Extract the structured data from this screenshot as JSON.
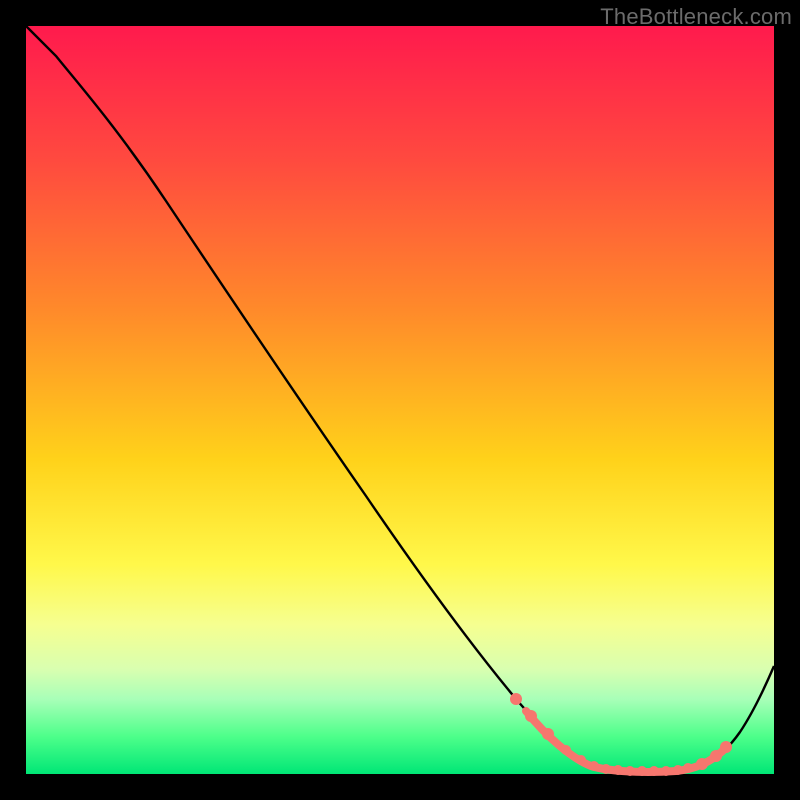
{
  "watermark": {
    "text": "TheBottleneck.com"
  },
  "chart_data": {
    "type": "line",
    "title": "",
    "xlabel": "",
    "ylabel": "",
    "xlim": [
      0,
      100
    ],
    "ylim": [
      0,
      100
    ],
    "grid": false,
    "series": [
      {
        "name": "bottleneck-curve",
        "x": [
          0,
          4,
          12,
          20,
          28,
          36,
          44,
          52,
          58,
          62,
          66,
          70,
          73,
          76,
          79,
          82,
          85,
          88,
          91,
          94,
          97,
          100
        ],
        "values": [
          100,
          96,
          87,
          76,
          65,
          54,
          43,
          32,
          24,
          18,
          12,
          7,
          4,
          2,
          1,
          0.5,
          0.5,
          1,
          3,
          6,
          12,
          20
        ]
      }
    ],
    "marker_band": {
      "x_start": 64,
      "x_end": 93,
      "color": "#f6766e"
    },
    "colors": {
      "line": "#000000",
      "markers": "#f6766e",
      "gradient_top": "#ff1a4d",
      "gradient_bottom": "#00e676",
      "background": "#000000"
    }
  }
}
